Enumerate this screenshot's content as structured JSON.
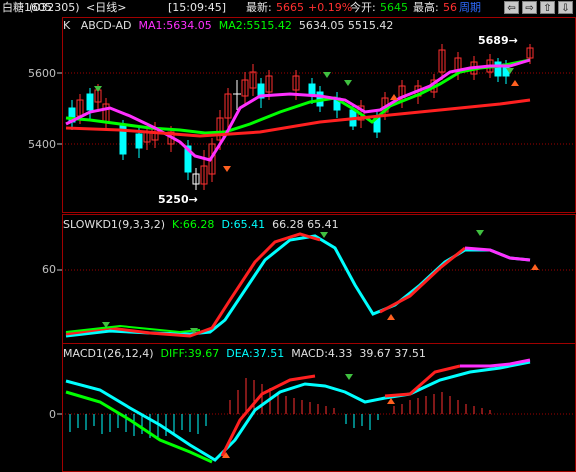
{
  "topbar": {
    "name": "白糖1605",
    "code": "(032305)",
    "period": "<日线>",
    "time": "[15:09:45]",
    "latest_label": "最新:",
    "latest_value": "5665",
    "change": "+0.19%",
    "open_label": "今开:",
    "open_value": "5645",
    "high_label": "最高:",
    "high_value": "56",
    "cycle_label": "周期",
    "nav_icons": [
      "prev-arrow-icon",
      "next-arrow-icon",
      "up-arrow-icon",
      "down-arrow-icon"
    ]
  },
  "main_panel": {
    "k_label": "K",
    "indicator": "ABCD-AD",
    "ma1_label": "MA1:5634.05",
    "ma2_label": "MA2:5515.42",
    "values_text": "5634.05 5515.42",
    "y_ticks": [
      "5600",
      "5400"
    ],
    "low_marker": "5250",
    "high_marker": "5689"
  },
  "kd_panel": {
    "title": "SLOWKD1(9,3,3,2)",
    "k_label": "K:66.28",
    "d_label": "D:65.41",
    "values_text": "66.28 65.41",
    "y_ticks": [
      "60"
    ]
  },
  "macd_panel": {
    "title": "MACD1(26,12,4)",
    "diff_label": "DIFF:39.67",
    "dea_label": "DEA:37.51",
    "macd_label": "MACD:4.33",
    "values_text": "39.67 37.51",
    "y_ticks": [
      "0"
    ]
  },
  "colors": {
    "up": "#ff3030",
    "down": "#00ffff",
    "ma1": "#ff30ff",
    "ma2": "#00ff00",
    "border": "#a00000"
  }
}
